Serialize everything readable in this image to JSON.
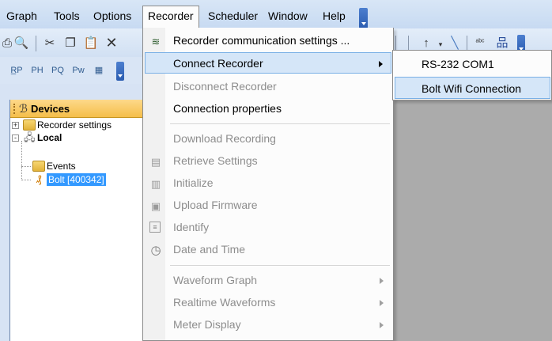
{
  "menubar": {
    "items": [
      {
        "label": "Graph",
        "mnemonic_underline": true
      },
      {
        "label": "Tools"
      },
      {
        "label": "Options"
      },
      {
        "label": "Recorder",
        "open": true
      },
      {
        "label": "Scheduler"
      },
      {
        "label": "Window"
      },
      {
        "label": "Help"
      }
    ]
  },
  "devices_panel": {
    "title": "Devices",
    "tree": [
      {
        "label": "Recorder settings",
        "level": 0,
        "expander": "+"
      },
      {
        "label": "Local",
        "level": 0,
        "expander": "-",
        "bold": true
      },
      {
        "label": "Events",
        "level": 1
      },
      {
        "label": "Bolt [400342]",
        "level": 1,
        "selected": true
      }
    ]
  },
  "recorder_menu": {
    "items": [
      {
        "label": "Recorder communication settings ...",
        "enabled": true,
        "icon": "plug-icon"
      },
      {
        "label": "Connect Recorder",
        "enabled": true,
        "submenu": true,
        "highlighted": true
      },
      {
        "label": "Disconnect Recorder",
        "enabled": false
      },
      {
        "label": "Connection properties",
        "enabled": true
      },
      {
        "label": "Download Recording",
        "enabled": false,
        "separator_before": true
      },
      {
        "label": "Retrieve Settings",
        "enabled": false,
        "icon": "retrieve-settings-icon"
      },
      {
        "label": "Initialize",
        "enabled": false,
        "icon": "initialize-icon"
      },
      {
        "label": "Upload Firmware",
        "enabled": false,
        "icon": "upload-firmware-icon"
      },
      {
        "label": "Identify",
        "enabled": false,
        "icon": "identify-icon"
      },
      {
        "label": "Date and Time",
        "enabled": false,
        "icon": "clock-icon"
      },
      {
        "label": "Waveform Graph",
        "enabled": false,
        "submenu": true,
        "separator_before": true
      },
      {
        "label": "Realtime Waveforms",
        "enabled": false,
        "submenu": true
      },
      {
        "label": "Meter Display",
        "enabled": false,
        "submenu": true
      }
    ]
  },
  "connect_submenu": {
    "items": [
      {
        "label": "RS-232 COM1"
      },
      {
        "label": "Bolt Wifi Connection",
        "highlighted": true
      }
    ]
  },
  "colors": {
    "menubar_bg": "#d0e0f4",
    "devices_header": "#f7c55a",
    "selection": "#3399ff",
    "menu_hover": "#d5e6f8",
    "disabled_text": "#8d8d8d"
  }
}
